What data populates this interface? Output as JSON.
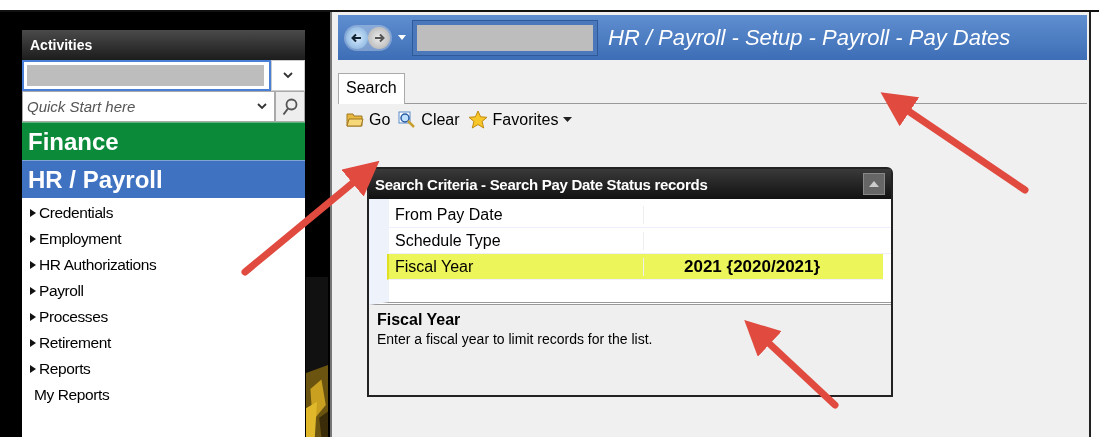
{
  "sidebar": {
    "title": "Activities",
    "quick_start": {
      "placeholder": "Quick Start here"
    },
    "modules": [
      {
        "label": "Finance",
        "color": "#0b8a3a"
      },
      {
        "label": "HR / Payroll",
        "color": "#3f72c0",
        "items": [
          {
            "label": "Credentials",
            "kind": "folder"
          },
          {
            "label": "Employment",
            "kind": "folder"
          },
          {
            "label": "HR Authorizations",
            "kind": "folder"
          },
          {
            "label": "Payroll",
            "kind": "folder"
          },
          {
            "label": "Processes",
            "kind": "folder"
          },
          {
            "label": "Retirement",
            "kind": "folder"
          },
          {
            "label": "Reports",
            "kind": "folder"
          },
          {
            "label": "My Reports",
            "kind": "link"
          }
        ]
      }
    ]
  },
  "window": {
    "title": "HR / Payroll - Setup - Payroll - Pay Dates"
  },
  "tabs": [
    {
      "label": "Search",
      "selected": true
    }
  ],
  "toolbar": [
    {
      "label": "Go",
      "kind": "go",
      "dropdown": false
    },
    {
      "label": "Clear",
      "kind": "clear",
      "dropdown": false
    },
    {
      "label": "Favorites",
      "kind": "favorites",
      "dropdown": true
    }
  ],
  "criteria": {
    "title": "Search Criteria - Search Pay Date Status records",
    "rows": [
      {
        "label": "From Pay Date",
        "selected": false
      },
      {
        "label": "Schedule Type",
        "selected": false
      },
      {
        "label": "Fiscal Year",
        "value": "2021 {2020/2021}",
        "selected": true
      }
    ],
    "help": {
      "title": "Fiscal Year",
      "text": "Enter a fiscal year to limit records for the list."
    }
  }
}
